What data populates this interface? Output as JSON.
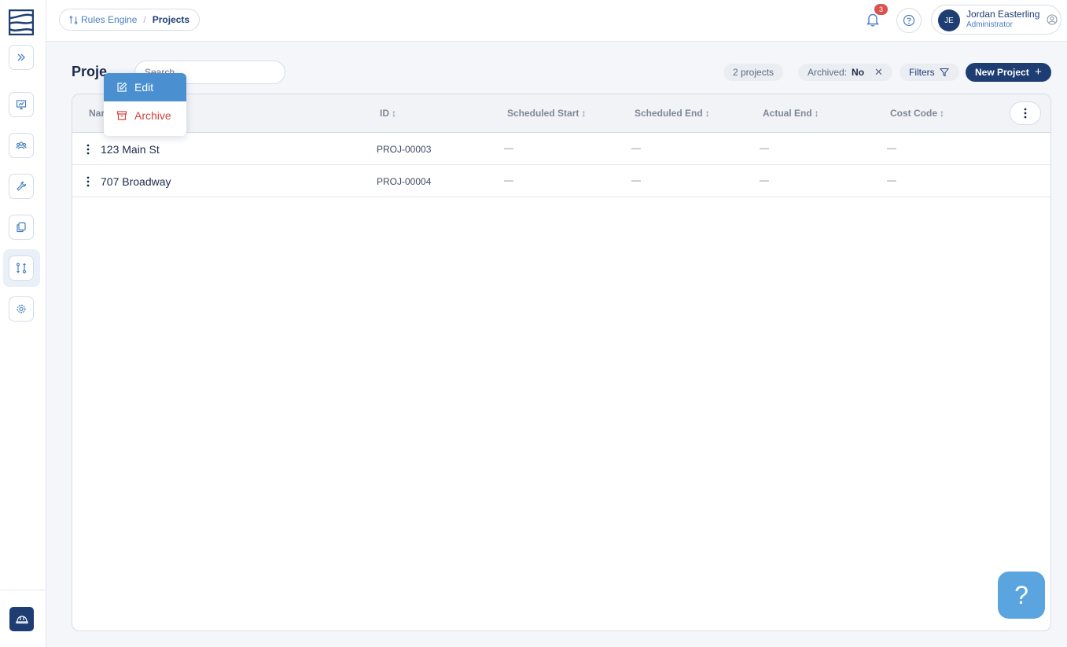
{
  "sidebar": {
    "items": [
      {
        "name": "expand",
        "icon": "chevrons-right-icon"
      },
      {
        "name": "dashboard",
        "icon": "presentation-icon"
      },
      {
        "name": "users",
        "icon": "users-icon"
      },
      {
        "name": "tools",
        "icon": "wrench-icon"
      },
      {
        "name": "documents",
        "icon": "copy-icon"
      },
      {
        "name": "rules-engine",
        "icon": "git-compare-icon",
        "active": true
      },
      {
        "name": "settings",
        "icon": "gear-icon"
      }
    ],
    "bottom_icon": "hard-hat-icon"
  },
  "breadcrumb": {
    "parent": "Rules Engine",
    "separator": "/",
    "current": "Projects"
  },
  "notifications": {
    "count": "3"
  },
  "user": {
    "initials": "JE",
    "name": "Jordan Easterling",
    "role": "Administrator"
  },
  "page": {
    "title": "Proje",
    "search_placeholder": "Search...",
    "search_visible": "h..."
  },
  "toolbar": {
    "count": "2 projects",
    "archived_label": "Archived:",
    "archived_value": "No",
    "archived_clear": "✕",
    "filters_label": "Filters",
    "new_label": "New Project",
    "new_plus": "+"
  },
  "table": {
    "columns": [
      {
        "label": "Nar",
        "sort": ""
      },
      {
        "label": "ID",
        "sort": "↕"
      },
      {
        "label": "Scheduled Start",
        "sort": "↕"
      },
      {
        "label": "Scheduled End",
        "sort": "↕"
      },
      {
        "label": "Actual End",
        "sort": "↕"
      },
      {
        "label": "Cost Code",
        "sort": "↕"
      }
    ],
    "rows": [
      {
        "name": "123 Main St",
        "id": "PROJ-00003",
        "scheduled_start": "—",
        "scheduled_end": "—",
        "actual_end": "—",
        "cost_code": "—"
      },
      {
        "name": "707 Broadway",
        "id": "PROJ-00004",
        "scheduled_start": "—",
        "scheduled_end": "—",
        "actual_end": "—",
        "cost_code": "—"
      }
    ]
  },
  "context_menu": {
    "edit": "Edit",
    "archive": "Archive"
  },
  "help_fab": "?",
  "colors": {
    "brand": "#1e3e73",
    "accent": "#4a90d0",
    "danger": "#d0433f",
    "fab": "#5aa5e0"
  }
}
